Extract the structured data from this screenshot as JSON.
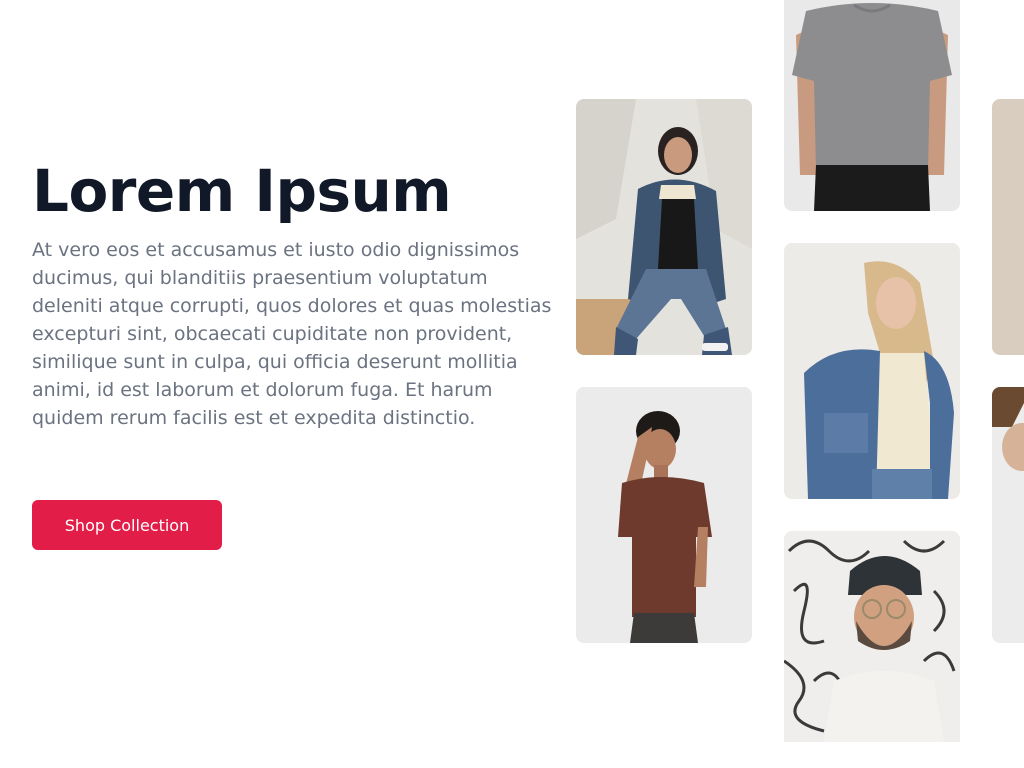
{
  "hero": {
    "title": "Lorem Ipsum",
    "description": "At vero eos et accusamus et iusto odio dignissimos ducimus, qui blanditiis praesentium voluptatum deleniti atque corrupti, quos dolores et quas molestias excepturi sint, obcaecati cupiditate non provident, similique sunt in culpa, qui officia deserunt mollitia animi, id est laborum et dolorum fuga. Et harum quidem rerum facilis est et expedita distinctio.",
    "cta_label": "Shop Collection"
  },
  "colors": {
    "accent": "#e11d48",
    "title": "#111827",
    "body_text": "#6b7280",
    "background": "#ffffff"
  },
  "gallery": {
    "items": [
      {
        "name": "woman-denim-jacket-black-tee"
      },
      {
        "name": "man-brown-tee"
      },
      {
        "name": "grey-tee-torso"
      },
      {
        "name": "blonde-woman-denim-jacket"
      },
      {
        "name": "man-beanie-glasses"
      },
      {
        "name": "partial-beige-photo"
      },
      {
        "name": "partial-man-photo"
      }
    ]
  }
}
